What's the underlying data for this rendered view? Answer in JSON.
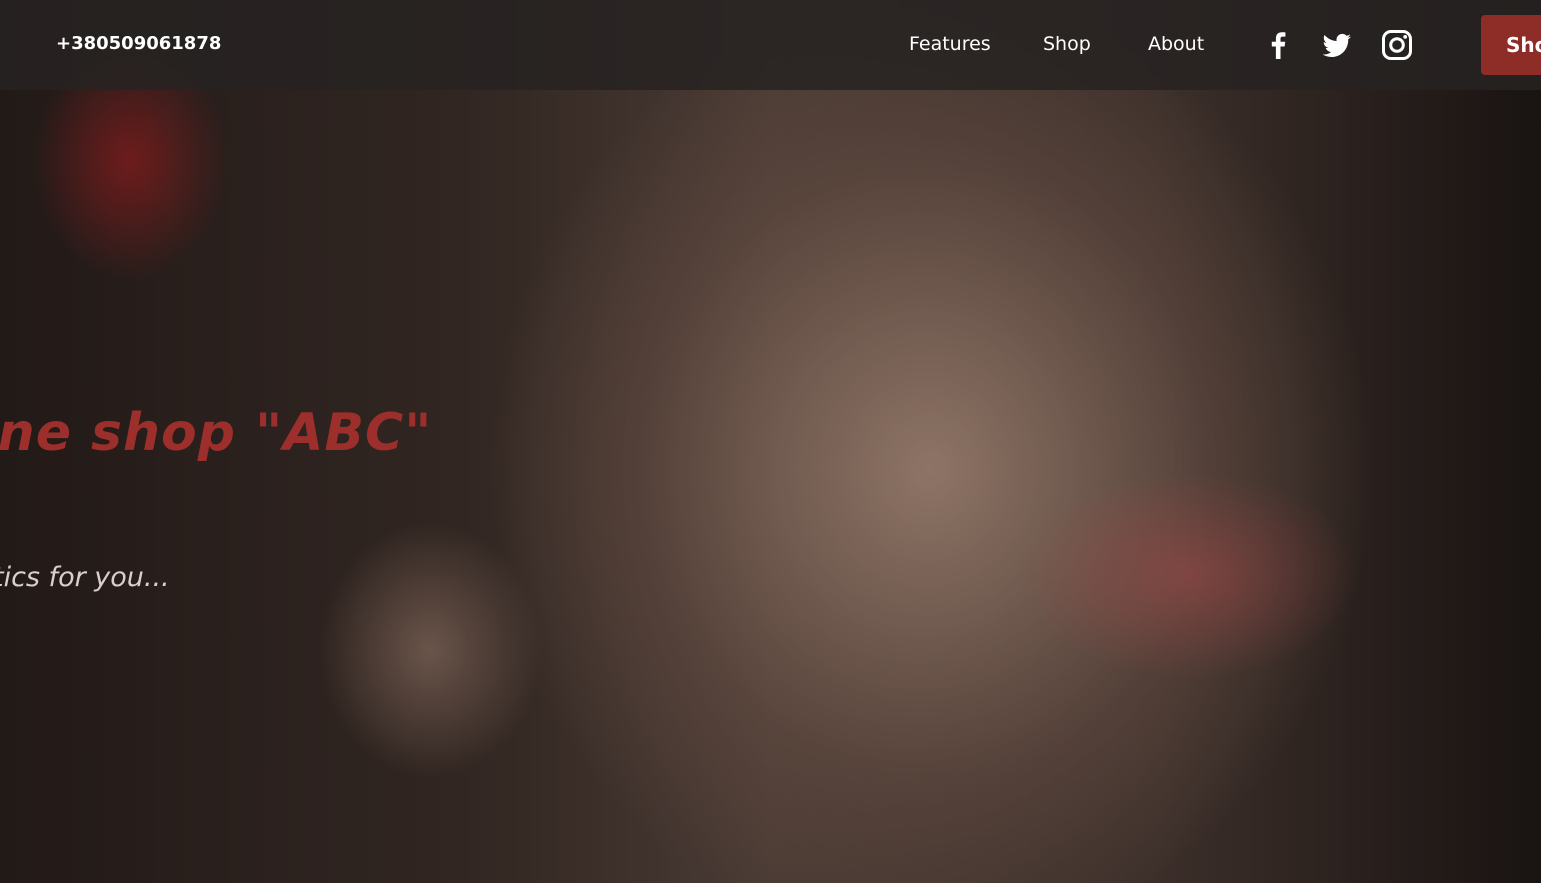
{
  "header": {
    "phone": "+380509061878",
    "nav": {
      "features": "Features",
      "shop": "Shop",
      "about": "About"
    },
    "social": [
      "facebook-icon",
      "twitter-icon",
      "instagram-icon"
    ],
    "shop_button_label": "Sho"
  },
  "hero": {
    "title": "nline shop \"ABC\"",
    "subtitle": "smetics for you..."
  },
  "colors": {
    "accent": "#8e2d28",
    "title": "#9c2f2b",
    "navbar": "#262322",
    "text": "#ffffff"
  }
}
